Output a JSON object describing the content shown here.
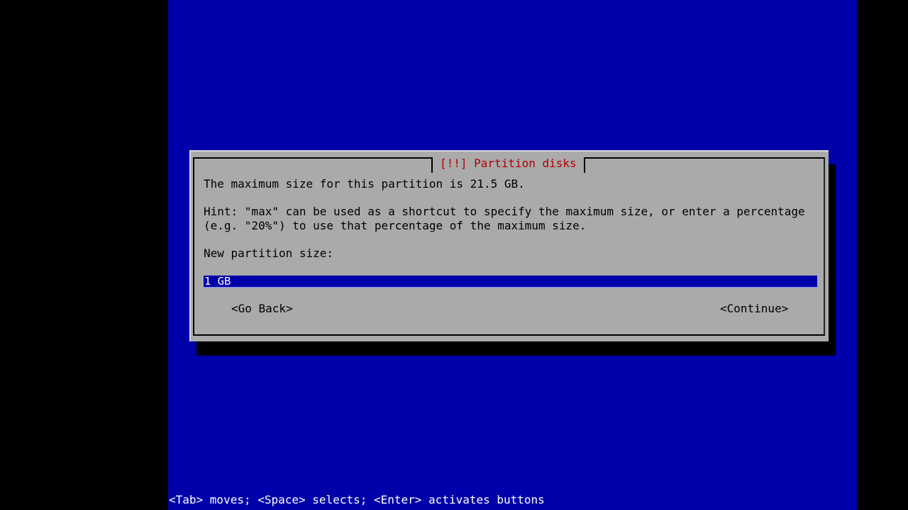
{
  "dialog": {
    "title": "[!!] Partition disks",
    "message": "The maximum size for this partition is 21.5 GB.",
    "hint_line1": "Hint: \"max\" can be used as a shortcut to specify the maximum size, or enter a percentage",
    "hint_line2": "(e.g. \"20%\") to use that percentage of the maximum size.",
    "field_label": "New partition size:",
    "field_value": "1 GB",
    "buttons": {
      "back": "<Go Back>",
      "continue": "<Continue>"
    }
  },
  "status_bar": "<Tab> moves; <Space> selects; <Enter> activates buttons",
  "colors": {
    "background": "#0000aa",
    "dialog": "#aaaaaa",
    "title": "#b00000"
  }
}
